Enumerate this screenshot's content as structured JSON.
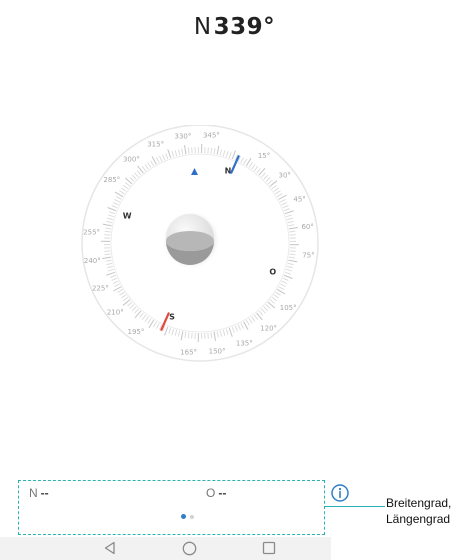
{
  "heading": {
    "direction": "N",
    "degrees": "339°"
  },
  "compass": {
    "heading_deg": 339,
    "cardinals": [
      {
        "label": "N",
        "deg": 0
      },
      {
        "label": "O",
        "deg": 90
      },
      {
        "label": "S",
        "deg": 180
      },
      {
        "label": "W",
        "deg": 270
      }
    ],
    "degree_labels": [
      "15°",
      "30°",
      "45°",
      "60°",
      "75°",
      "105°",
      "120°",
      "135°",
      "150°",
      "165°",
      "195°",
      "210°",
      "225°",
      "240°",
      "255°",
      "285°",
      "300°",
      "315°",
      "330°",
      "345°"
    ],
    "colors": {
      "north_needle": "#2f6fc9",
      "south_needle": "#e2483d",
      "marker": "#2f6fc9"
    }
  },
  "coords": {
    "lat_label": "N",
    "lat_value": "--",
    "lng_label": "O",
    "lng_value": "--"
  },
  "pager": {
    "count": 2,
    "active": 0
  },
  "callout": {
    "line1": "Breitengrad,",
    "line2": "Längengrad"
  },
  "navbar": {
    "icons": [
      "back-icon",
      "home-icon",
      "recents-icon"
    ]
  },
  "colors": {
    "accent": "#2bb3b3",
    "info": "#2f7fcb"
  }
}
